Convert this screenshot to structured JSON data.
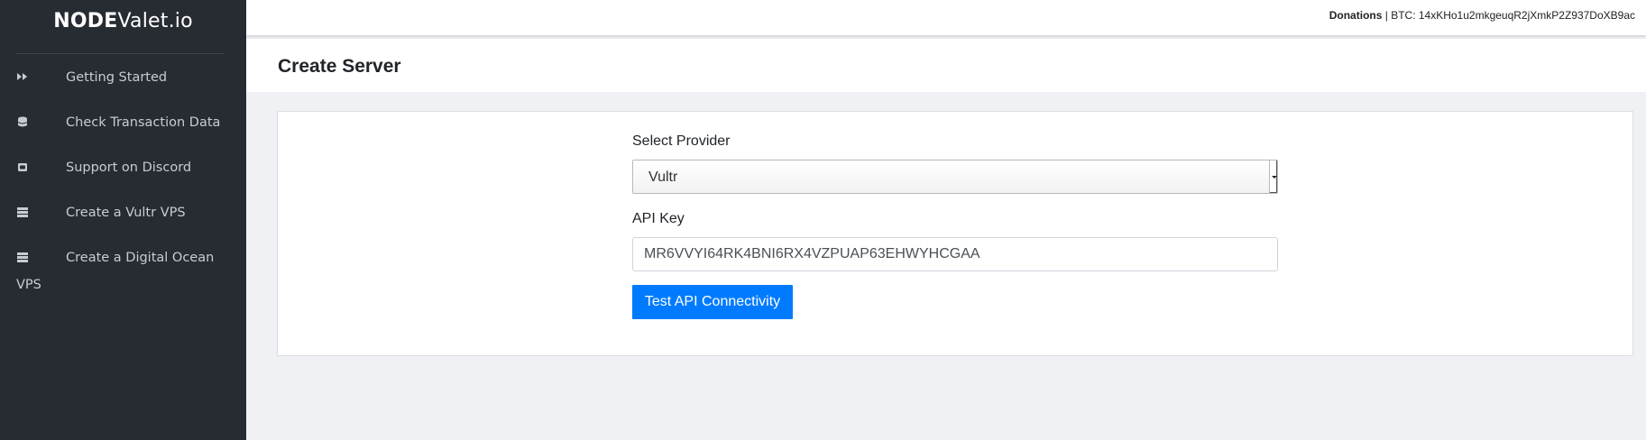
{
  "brand": {
    "bold": "NODE",
    "rest": "Valet.io"
  },
  "sidebar": {
    "items": [
      {
        "label": "Getting Started",
        "icon": "fast-forward-icon"
      },
      {
        "label": "Check Transaction Data",
        "icon": "database-icon"
      },
      {
        "label": "Support on Discord",
        "icon": "discord-icon"
      },
      {
        "label": "Create a Vultr VPS",
        "icon": "server-icon"
      },
      {
        "label": "Create a Digital Ocean",
        "label_wrap": "VPS",
        "icon": "server-icon"
      }
    ]
  },
  "topbar": {
    "donations_label": "Donations",
    "btc_text": " | BTC: 14xKHo1u2mkgeuqR2jXmkP2Z937DoXB9ac"
  },
  "page": {
    "title": "Create Server"
  },
  "form": {
    "provider_label": "Select Provider",
    "provider_value": "Vultr",
    "api_key_label": "API Key",
    "api_key_value": "MR6VVYI64RK4BNI6RX4VZPUAP63EHWYHCGAA",
    "test_button_label": "Test API Connectivity"
  },
  "colors": {
    "sidebar_bg": "#272c33",
    "primary": "#007bff",
    "content_bg": "#f0f1f5"
  }
}
